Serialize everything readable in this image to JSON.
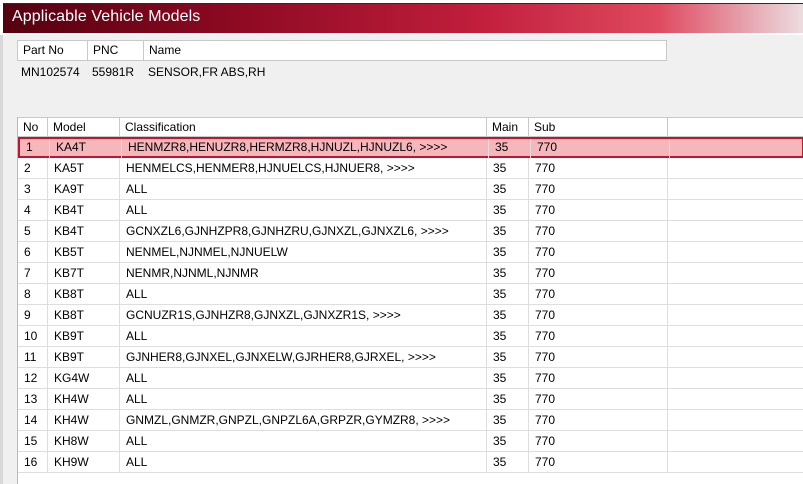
{
  "window": {
    "title": "Applicable Vehicle Models"
  },
  "part_info": {
    "headers": [
      "Part No",
      "PNC",
      "Name"
    ],
    "part_no": "MN102574",
    "pnc": "55981R",
    "name": "SENSOR,FR ABS,RH"
  },
  "table": {
    "headers": [
      "No",
      "Model",
      "Classification",
      "Main",
      "Sub"
    ],
    "selected_row": 1,
    "rows": [
      {
        "no": "1",
        "model": "KA4T",
        "classification": "HENMZR8,HENUZR8,HERMZR8,HJNUZL,HJNUZL6,  >>>>",
        "main": "35",
        "sub": "770"
      },
      {
        "no": "2",
        "model": "KA5T",
        "classification": "HENMELCS,HENMER8,HJNUELCS,HJNUER8,  >>>>",
        "main": "35",
        "sub": "770"
      },
      {
        "no": "3",
        "model": "KA9T",
        "classification": "ALL",
        "main": "35",
        "sub": "770"
      },
      {
        "no": "4",
        "model": "KB4T",
        "classification": "ALL",
        "main": "35",
        "sub": "770"
      },
      {
        "no": "5",
        "model": "KB4T",
        "classification": "GCNXZL6,GJNHZPR8,GJNHZRU,GJNXZL,GJNXZL6,  >>>>",
        "main": "35",
        "sub": "770"
      },
      {
        "no": "6",
        "model": "KB5T",
        "classification": "NENMEL,NJNMEL,NJNUELW",
        "main": "35",
        "sub": "770"
      },
      {
        "no": "7",
        "model": "KB7T",
        "classification": "NENMR,NJNML,NJNMR",
        "main": "35",
        "sub": "770"
      },
      {
        "no": "8",
        "model": "KB8T",
        "classification": "ALL",
        "main": "35",
        "sub": "770"
      },
      {
        "no": "9",
        "model": "KB8T",
        "classification": "GCNUZR1S,GJNHZR8,GJNXZL,GJNXZR1S,  >>>>",
        "main": "35",
        "sub": "770"
      },
      {
        "no": "10",
        "model": "KB9T",
        "classification": "ALL",
        "main": "35",
        "sub": "770"
      },
      {
        "no": "11",
        "model": "KB9T",
        "classification": "GJNHER8,GJNXEL,GJNXELW,GJRHER8,GJRXEL,  >>>>",
        "main": "35",
        "sub": "770"
      },
      {
        "no": "12",
        "model": "KG4W",
        "classification": "ALL",
        "main": "35",
        "sub": "770"
      },
      {
        "no": "13",
        "model": "KH4W",
        "classification": "ALL",
        "main": "35",
        "sub": "770"
      },
      {
        "no": "14",
        "model": "KH4W",
        "classification": "GNMZL,GNMZR,GNPZL,GNPZL6A,GRPZR,GYMZR8,  >>>>",
        "main": "35",
        "sub": "770"
      },
      {
        "no": "15",
        "model": "KH8W",
        "classification": "ALL",
        "main": "35",
        "sub": "770"
      },
      {
        "no": "16",
        "model": "KH9W",
        "classification": "ALL",
        "main": "35",
        "sub": "770"
      }
    ]
  },
  "colors": {
    "title_bar": "#8f0a23",
    "selected_row_fill": "#f5b6bc",
    "selected_row_border": "#c2142c"
  }
}
